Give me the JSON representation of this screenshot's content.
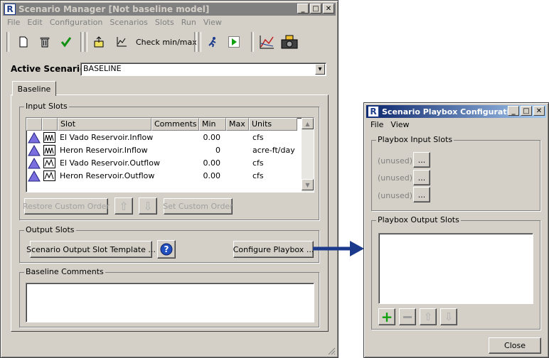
{
  "scenario_manager": {
    "title": "Scenario Manager [Not baseline model]",
    "menus": [
      "File",
      "Edit",
      "Configuration",
      "Scenarios",
      "Slots",
      "Run",
      "View"
    ],
    "toolbar": {
      "check_label": "Check min/max"
    },
    "active_scenario_label": "Active Scenario:",
    "active_scenario_value": "BASELINE",
    "tab_label": "Baseline",
    "input_slots": {
      "title": "Input Slots",
      "columns": [
        "Slot",
        "Comments",
        "Min",
        "Max",
        "Units"
      ],
      "rows": [
        {
          "slot": "El Vado Reservoir.Inflow",
          "comments": "",
          "min": "0.00",
          "max": "",
          "units": "cfs"
        },
        {
          "slot": "Heron Reservoir.Inflow",
          "comments": "",
          "min": "0",
          "max": "",
          "units": "acre-ft/day"
        },
        {
          "slot": "El Vado Reservoir.Outflow",
          "comments": "",
          "min": "0.00",
          "max": "",
          "units": "cfs"
        },
        {
          "slot": "Heron Reservoir.Outflow",
          "comments": "",
          "min": "0.00",
          "max": "",
          "units": "cfs"
        }
      ],
      "restore_label": "Restore Custom Order",
      "set_label": "Set Custom Order"
    },
    "output_slots": {
      "title": "Output Slots",
      "template_label": "Scenario Output Slot Template ...",
      "playbox_label": "Configure Playbox ..."
    },
    "baseline_comments": {
      "title": "Baseline Comments"
    }
  },
  "playbox": {
    "title": "Scenario Playbox Configuration",
    "menus": [
      "File",
      "View"
    ],
    "input_slots_title": "Playbox Input Slots",
    "input_slots": [
      "(unused)",
      "(unused)",
      "(unused)"
    ],
    "ellipsis": "...",
    "output_slots_title": "Playbox Output Slots",
    "close_label": "Close"
  },
  "colors": {
    "arrow": "#1b3a8c",
    "active_title": "#0a246a",
    "inactive_title": "#808080"
  }
}
